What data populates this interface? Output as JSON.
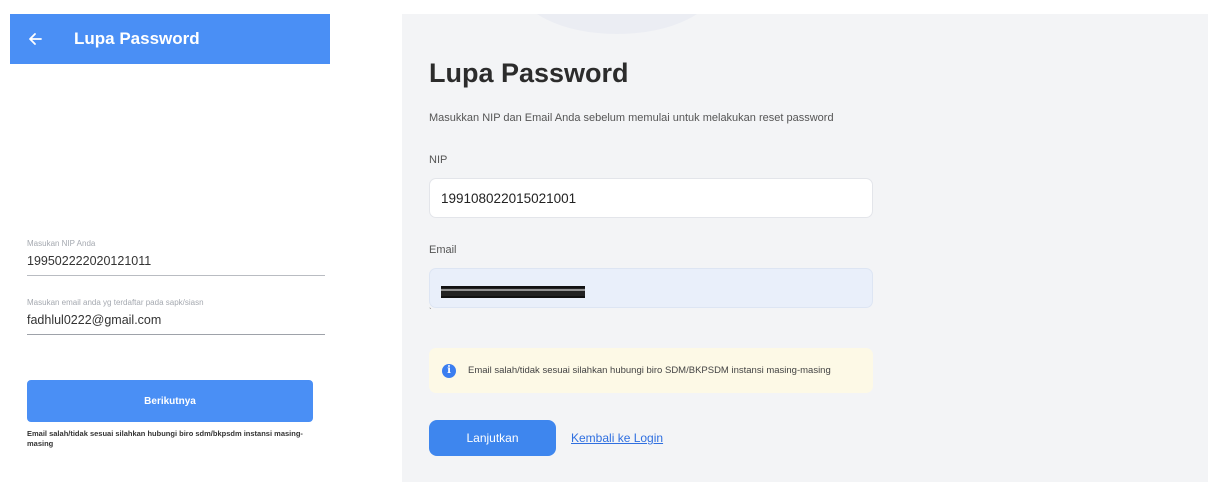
{
  "mobile": {
    "header": {
      "title": "Lupa Password",
      "back_icon": "arrow-left-icon"
    },
    "nip_field": {
      "label": "Masukan NIP Anda",
      "value": "199502222020121011"
    },
    "email_field": {
      "label": "Masukan email anda yg terdaftar pada sapk/siasn",
      "value": "fadhlul0222@gmail.com"
    },
    "next_button": "Berikutnya",
    "note": "Email salah/tidak sesuai silahkan hubungi biro sdm/bkpsdm instansi masing-masing"
  },
  "desktop": {
    "title": "Lupa Password",
    "subtitle": "Masukkan NIP dan Email Anda sebelum memulai untuk melakukan reset password",
    "nip": {
      "label": "NIP",
      "value": "199108022015021001"
    },
    "email": {
      "label": "Email",
      "value": ""
    },
    "alert": {
      "icon": "info-icon",
      "text": "Email salah/tidak sesuai silahkan hubungi biro SDM/BKPSDM instansi masing-masing"
    },
    "continue_button": "Lanjutkan",
    "back_link": "Kembali ke Login"
  },
  "colors": {
    "primary": "#4a8ff5",
    "desktop_primary": "#3e86ee",
    "link": "#2f6fe0",
    "alert_bg": "#fdf9e6"
  }
}
